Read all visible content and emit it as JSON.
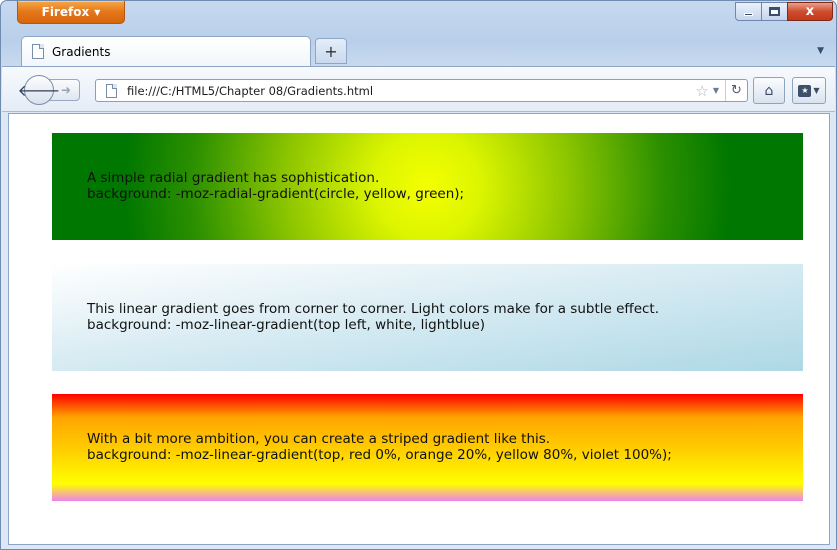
{
  "browser": {
    "app_button_label": "Firefox",
    "caption": {
      "close_label": "x"
    },
    "tab": {
      "title": "Gradients",
      "new_tab_label": "+"
    },
    "nav": {
      "url": "file:///C:/HTML5/Chapter 08/Gradients.html"
    }
  },
  "panels": [
    {
      "caption": "A simple radial gradient has sophistication.",
      "code": "background: -moz-radial-gradient(circle, yellow, green);",
      "colors": [
        "#ffff00",
        "#008000"
      ]
    },
    {
      "caption": "This linear gradient goes from corner to corner. Light colors make for a subtle effect.",
      "code": "background: -moz-linear-gradient(top left, white, lightblue)",
      "colors": [
        "#ffffff",
        "#add8e6"
      ]
    },
    {
      "caption": "With a bit more ambition, you can create a striped gradient like this.",
      "code": "background: -moz-linear-gradient(top, red 0%, orange 20%, yellow 80%, violet 100%);",
      "colors": [
        "#ff0000",
        "#ffa500",
        "#ffff00",
        "#ee82ee"
      ]
    }
  ],
  "icons": [
    "firefox-menu-caret-icon",
    "minimize-icon",
    "maximize-icon",
    "close-icon",
    "page-icon",
    "back-arrow-icon",
    "forward-arrow-icon",
    "star-icon",
    "reload-icon",
    "home-icon",
    "bookmarks-icon"
  ]
}
